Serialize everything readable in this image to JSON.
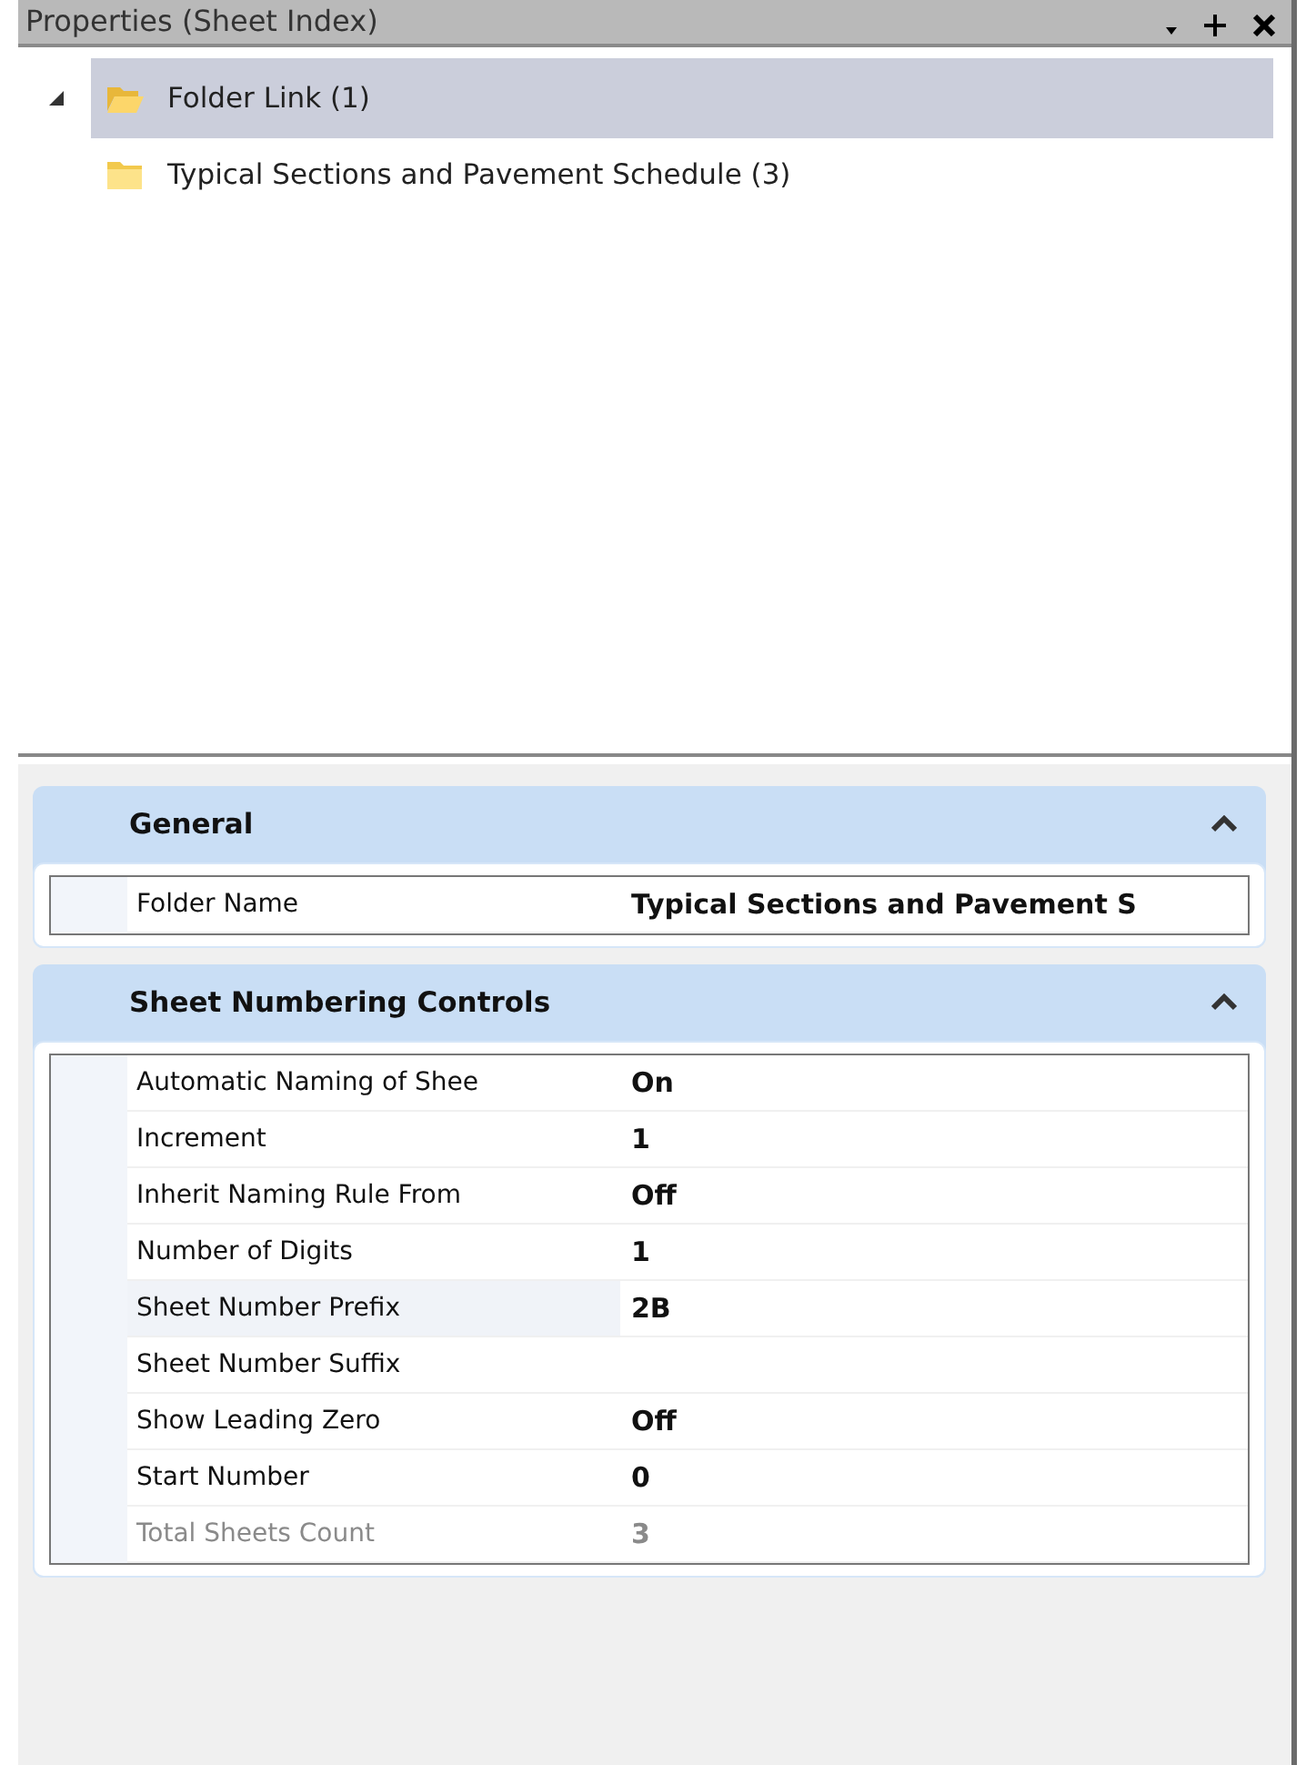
{
  "panel": {
    "title": "Properties (Sheet Index)"
  },
  "tree": [
    {
      "label": "Folder Link (1)",
      "expanded": true,
      "selected": true,
      "children": [
        {
          "label": "Typical Sections and Pavement Schedule (3)",
          "selected": false
        }
      ]
    }
  ],
  "categories": [
    {
      "title": "General",
      "expanded": true,
      "properties": [
        {
          "name": "Folder Name",
          "value": "Typical Sections and Pavement S",
          "selected": false,
          "disabled": false
        }
      ]
    },
    {
      "title": "Sheet Numbering Controls",
      "expanded": true,
      "properties": [
        {
          "name": "Automatic Naming of Shee",
          "value": "On",
          "selected": false,
          "disabled": false
        },
        {
          "name": "Increment",
          "value": "1",
          "selected": false,
          "disabled": false
        },
        {
          "name": "Inherit Naming Rule From",
          "value": "Off",
          "selected": false,
          "disabled": false
        },
        {
          "name": "Number of Digits",
          "value": "1",
          "selected": false,
          "disabled": false
        },
        {
          "name": "Sheet Number Prefix",
          "value": "2B",
          "selected": true,
          "disabled": false
        },
        {
          "name": "Sheet Number Suffix",
          "selected": false,
          "disabled": false
        },
        {
          "name": "Show Leading Zero",
          "value": "Off",
          "selected": false,
          "disabled": false
        },
        {
          "name": "Start Number",
          "value": "0",
          "selected": false,
          "disabled": false
        },
        {
          "name": "Total Sheets Count",
          "value": "3",
          "selected": false,
          "disabled": true
        }
      ]
    }
  ]
}
